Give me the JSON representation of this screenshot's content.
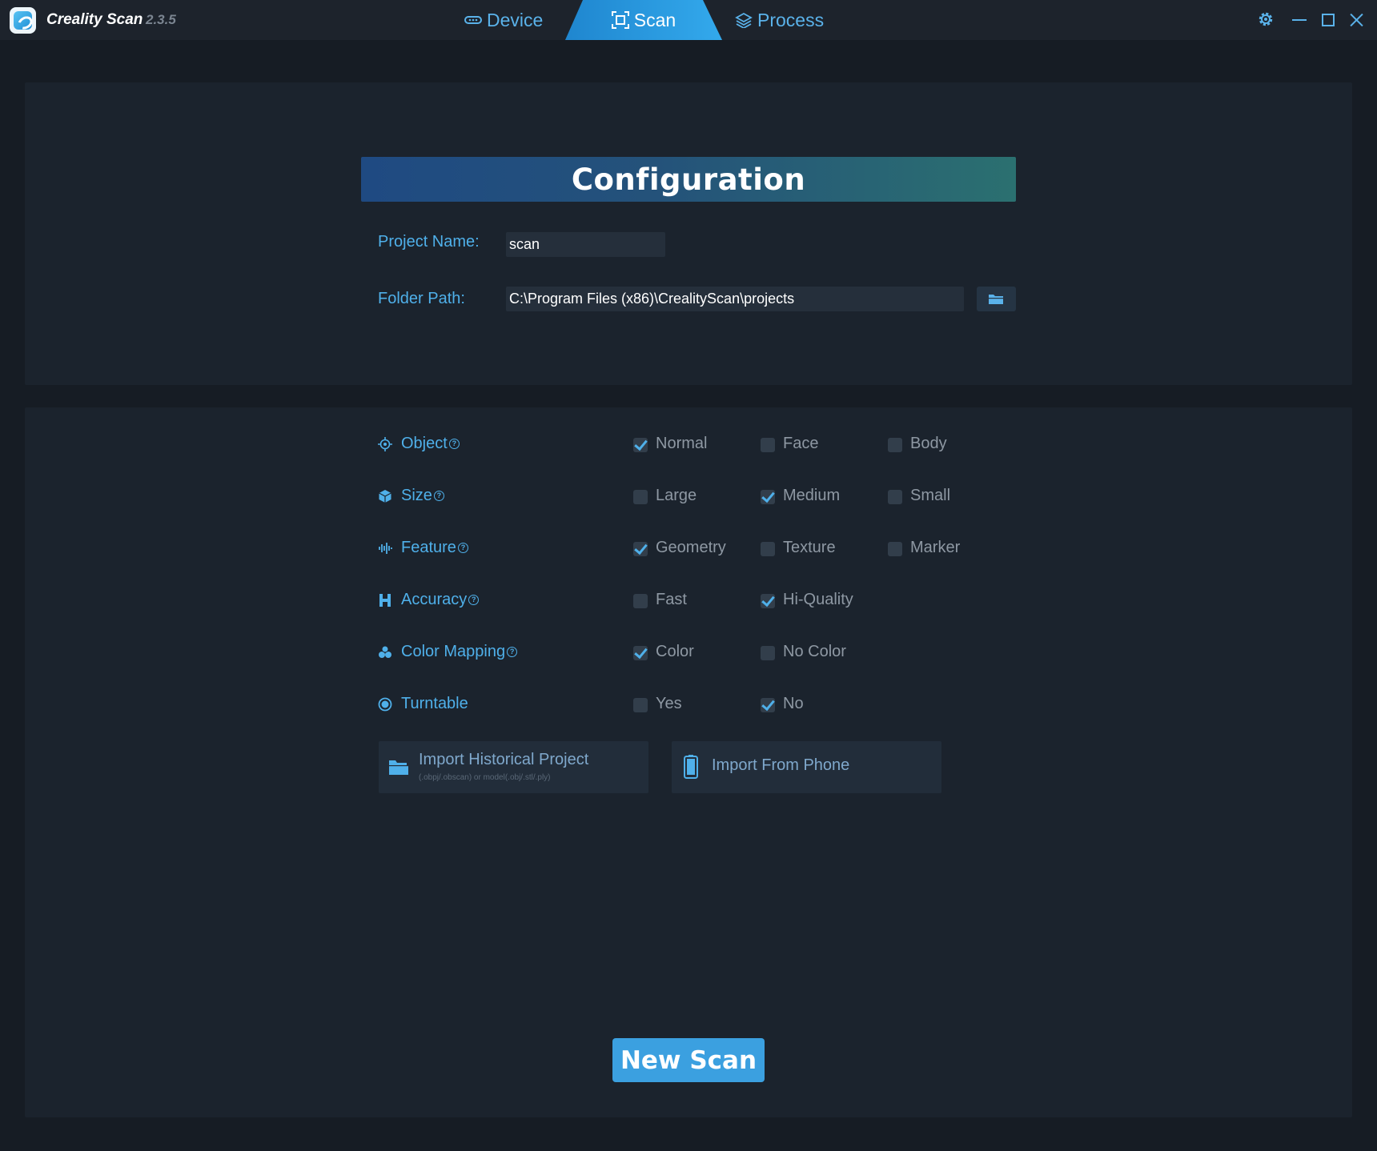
{
  "app": {
    "name": "Creality Scan",
    "version": "2.3.5"
  },
  "tabs": {
    "device": "Device",
    "scan": "Scan",
    "process": "Process",
    "active": "Scan"
  },
  "config": {
    "title": "Configuration",
    "project_name_label": "Project Name:",
    "project_name_value": "scan",
    "folder_path_label": "Folder Path:",
    "folder_path_value": "C:\\Program Files (x86)\\CrealityScan\\projects"
  },
  "options": {
    "object": {
      "label": "Object",
      "choices": [
        "Normal",
        "Face",
        "Body"
      ],
      "selected": "Normal"
    },
    "size": {
      "label": "Size",
      "choices": [
        "Large",
        "Medium",
        "Small"
      ],
      "selected": "Medium"
    },
    "feature": {
      "label": "Feature",
      "choices": [
        "Geometry",
        "Texture",
        "Marker"
      ],
      "selected": "Geometry"
    },
    "accuracy": {
      "label": "Accuracy",
      "choices": [
        "Fast",
        "Hi-Quality"
      ],
      "selected": "Hi-Quality"
    },
    "color_mapping": {
      "label": "Color Mapping",
      "choices": [
        "Color",
        "No Color"
      ],
      "selected": "Color"
    },
    "turntable": {
      "label": "Turntable",
      "choices": [
        "Yes",
        "No"
      ],
      "selected": "No"
    }
  },
  "import": {
    "historical_title": "Import Historical Project",
    "historical_sub": "(.obpj/.obscan) or model(.obj/.stl/.ply)",
    "phone_title": "Import From Phone"
  },
  "new_scan_label": "New Scan",
  "colors": {
    "accent": "#3ba0e0",
    "label_blue": "#4fb0ea",
    "panel": "#1b232d",
    "background": "#161c24"
  }
}
